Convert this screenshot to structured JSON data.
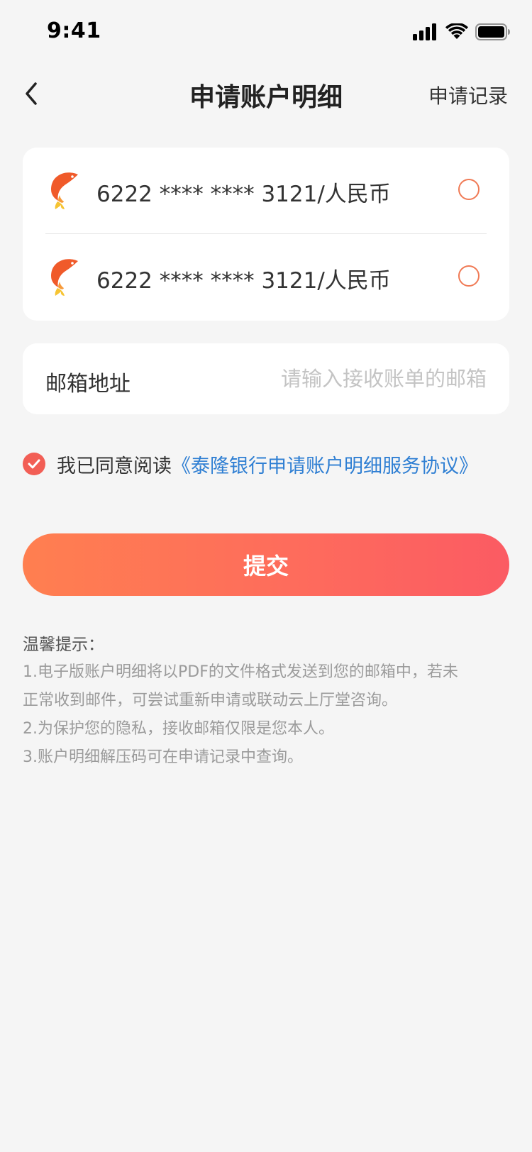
{
  "status_bar": {
    "time": "9:41",
    "icons": [
      "signal-icon",
      "wifi-icon",
      "battery-icon"
    ]
  },
  "nav": {
    "back_icon": "chevron-left-icon",
    "title": "申请账户明细",
    "right_label": "申请记录"
  },
  "accounts": [
    {
      "label": "6222 **** **** 3121/人民币",
      "icon": "koi-logo-icon",
      "selected": false
    },
    {
      "label": "6222 **** **** 3121/人民币",
      "icon": "koi-logo-icon",
      "selected": false
    }
  ],
  "email": {
    "label": "邮箱地址",
    "value": "",
    "placeholder": "请输入接收账单的邮箱"
  },
  "agreement": {
    "checked": true,
    "text": "我已同意阅读",
    "link": "《泰隆银行申请账户明细服务协议》"
  },
  "submit": {
    "label": "提交"
  },
  "tips": {
    "title": "温馨提示：",
    "lines": [
      "1.电子版账户明细将以PDF的文件格式发送到您的邮箱中，若未",
      "正常收到邮件，可尝试重新申请或联动云上厅堂咨询。",
      "2.为保护您的隐私，接收邮箱仅限是您本人。",
      "3.账户明细解压码可在申请记录中查询。"
    ]
  },
  "colors": {
    "accent": "#f25e55",
    "link": "#2f7fd3",
    "radio_border": "#f07a55",
    "button_gradient_start": "#ff7f50",
    "button_gradient_end": "#fb5b63",
    "background": "#f5f5f5"
  }
}
